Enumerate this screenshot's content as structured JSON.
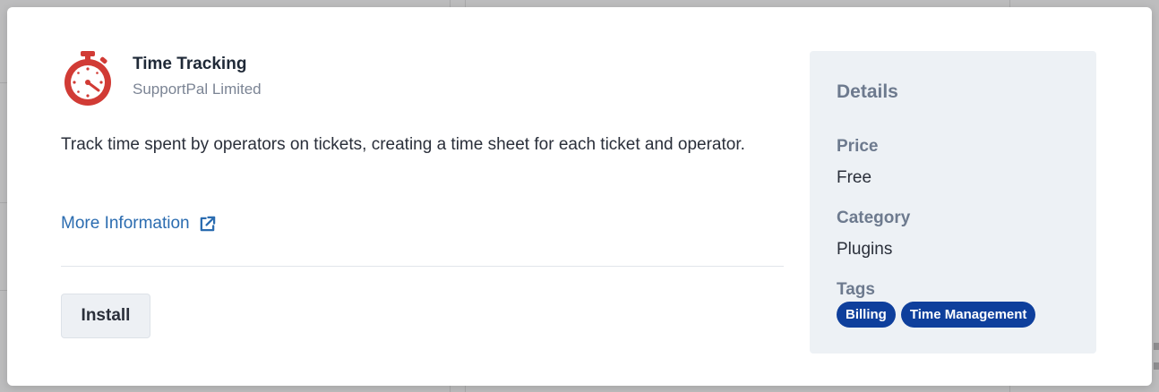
{
  "plugin": {
    "name": "Time Tracking",
    "vendor": "SupportPal Limited",
    "description": "Track time spent by operators on tickets, creating a time sheet for each ticket and operator.",
    "logo_icon": "stopwatch-icon",
    "more_info_label": "More Information",
    "install_label": "Install"
  },
  "details": {
    "title": "Details",
    "price_label": "Price",
    "price_value": "Free",
    "category_label": "Category",
    "category_value": "Plugins",
    "tags_label": "Tags",
    "tags": [
      "Billing",
      "Time Management"
    ]
  },
  "colors": {
    "link": "#2b6cb0",
    "tag_bg": "#0e3f9c",
    "logo_red": "#d13b35",
    "panel_bg": "#edf1f5"
  }
}
